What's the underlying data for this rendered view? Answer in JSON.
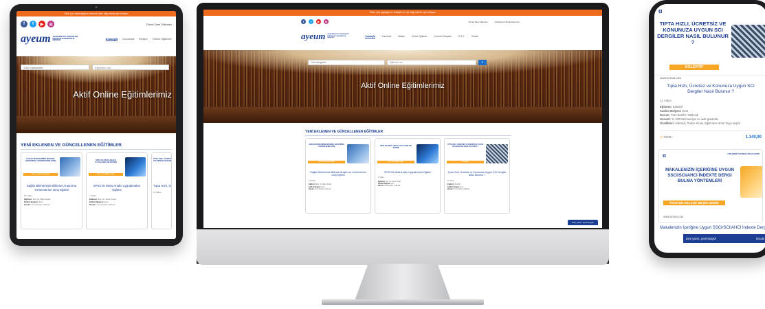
{
  "site": {
    "announcement": "Sizin için yaptığımız kolaylık en iyi bilgi edinin için tıklayın",
    "announcement_tablet": "Sizin için aktarıldığına bakmak ister bilgi almak için tıklayın",
    "logo_text": "ayeum",
    "logo_tagline_lines": [
      "AKADEMİSYEN YÖNTEMLERİ",
      "EĞİTİM VE DANIŞMANLIK",
      "MERKEZİ"
    ],
    "social_icons": [
      "facebook-icon",
      "twitter-icon",
      "youtube-icon",
      "instagram-icon"
    ],
    "top_links": {
      "free_videos": "Örnek Ders Videoları",
      "login": "Giriş/Kayıt Olmak İstiyorum"
    },
    "menu": [
      "Anasayfa",
      "Kurumsal",
      "İletişim",
      "Online Eğitimler",
      "Kurulum Detayları",
      "S.S.S.",
      "Destek"
    ],
    "menu_tablet": [
      "Anasayfa",
      "Kurumsal",
      "İletişim",
      "Online Eğitimler"
    ],
    "menu_active_index": 0,
    "hero_title": "Aktif Online Eğitimlerimiz",
    "search": {
      "category_placeholder": "Tüm Kategoriler",
      "keyword_placeholder": "Eğitimleri ara"
    },
    "section_title": "YENİ EKLENEN VE GÜNCELLENEN EĞİTİMLER",
    "chat_label": "Bize yazın, çevrimiçiyiz!",
    "chat_action": "İmzala"
  },
  "courses": [
    {
      "image_title": "SAĞLIK BİLİMLERİNDE BİLİMSEL ARAŞTIRMA YÖNTEMLERİNE GİRİŞ",
      "author": "DOÇ. DR. BİLGE DOĞAN",
      "name": "Sağlık Bilimlerinde Bilimsel Araştırma Yöntemlerine Giriş Eğitimi",
      "videos": "15 Video",
      "meta": [
        {
          "k": "Eğitmen:",
          "v": "Doç. Dr. Bilge Doğan"
        },
        {
          "k": "Katılım Belgesi:",
          "v": "Evet"
        },
        {
          "k": "Durum:",
          "v": "Tüm Dersler Yüklendi"
        },
        {
          "k": "Garanti:",
          "v": "% 100 Memnuniyet ve iade garantisi"
        }
      ]
    },
    {
      "image_title": "SPSS İLE META-ANALİZ UYGULAMALARI EĞİTİMİ",
      "author": "DOÇ. DR. DEMİR TOPAL",
      "name": "SPSS ile Meta-Analiz Uygulamaları Eğitimi",
      "videos": "7 Video",
      "meta": [
        {
          "k": "Eğitmen:",
          "v": "Doç. Dr. Demir Topal"
        },
        {
          "k": "Katılım Belgesi:",
          "v": "Evet"
        },
        {
          "k": "Durum:",
          "v": "Tüm Dersler Yüklendi"
        },
        {
          "k": "Garanti:",
          "v": "% 100 Memnuniyet ve iade garantisi"
        }
      ]
    },
    {
      "image_title": "TIPTA HIZLI, ÜCRETSİZ VE KONUNUZA UYGUN SCI DERGİLER NASIL BULUNUR ?",
      "author": "KOLEKTİF",
      "name": "Tıpta Hızlı, Ücretsiz ve Konunuza Uygun SCI Dergiler Nasıl Bulunur ?",
      "videos": "11 Video",
      "meta": [
        {
          "k": "Eğitmen:",
          "v": "Kolektif"
        },
        {
          "k": "Katılım Belgesi:",
          "v": "Evet"
        },
        {
          "k": "Durum:",
          "v": "Tüm Dersler Yüklendi"
        },
        {
          "k": "Garanti:",
          "v": "% 100 Memnuniyet ve iade garantisi"
        },
        {
          "k": "Özellikleri:",
          "v": "İndirekli, Online Sınav, Eğitimlere ömür boyu erişim"
        }
      ],
      "duration": "70.00+",
      "price": "1.149,90"
    },
    {
      "image_title": "MAKALENİZİN İÇERİĞİNE UYGUN SSCI/SCI/AHCI İNDEXTE DERGİ BULMA YÖNTEMLERİ",
      "author": "PROF.DR.SELÇUK BEŞİR DEMİR",
      "name": "Makalenizin İçeriğine Uygun SSCI/SCI/AHCI İndexte Dergi Bulma Yöntemleri",
      "badge": "YÜKLEMESİ YAKINDA YAPILACAKTIR"
    }
  ],
  "brand_url": "WWW.AYEUM.COM",
  "colors": {
    "accent": "#ee6a1c",
    "brand": "#1c3f94",
    "author_bg": "#f6a623",
    "price": "#1c6fd1"
  }
}
